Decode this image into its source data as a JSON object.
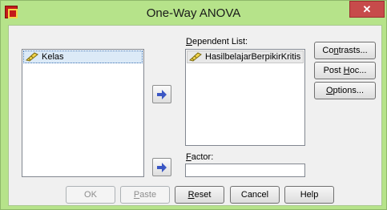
{
  "window": {
    "title": "One-Way ANOVA",
    "close_label": "✕"
  },
  "source_list": {
    "items": [
      {
        "label": "Kelas",
        "icon": "ruler-icon"
      }
    ]
  },
  "dependent": {
    "label": "Dependent List:",
    "items": [
      {
        "label": "HasilbelajarBerpikirKritis",
        "icon": "ruler-icon"
      }
    ]
  },
  "factor": {
    "label": "Factor:",
    "value": ""
  },
  "side_buttons": {
    "contrasts": "Contrasts...",
    "post_hoc": "Post Hoc...",
    "options": "Options..."
  },
  "bottom_buttons": {
    "ok": "OK",
    "paste": "Paste",
    "reset": "Reset",
    "cancel": "Cancel",
    "help": "Help"
  },
  "colors": {
    "frame": "#b6e38a",
    "close": "#c74b4b",
    "arrow": "#3b57c4",
    "selection": "#dceaf7"
  }
}
